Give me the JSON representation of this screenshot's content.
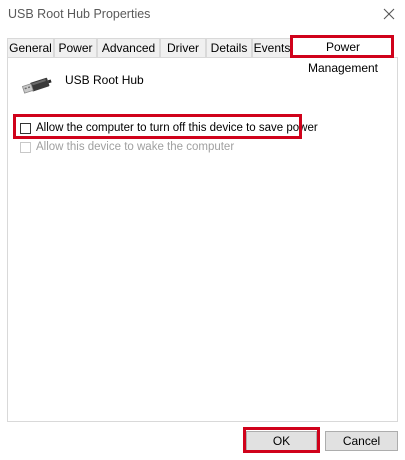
{
  "window": {
    "title": "USB Root Hub Properties",
    "close_icon": "close-icon"
  },
  "tabs": [
    {
      "label": "General"
    },
    {
      "label": "Power"
    },
    {
      "label": "Advanced"
    },
    {
      "label": "Driver"
    },
    {
      "label": "Details"
    },
    {
      "label": "Events"
    },
    {
      "label": "Power Management",
      "active": true
    }
  ],
  "device": {
    "icon": "usb-icon",
    "name": "USB Root Hub"
  },
  "options": [
    {
      "label": "Allow the computer to turn off this device to save power",
      "checked": false,
      "enabled": true
    },
    {
      "label": "Allow this device to wake the computer",
      "checked": false,
      "enabled": false
    }
  ],
  "buttons": {
    "ok": "OK",
    "cancel": "Cancel"
  },
  "colors": {
    "highlight": "#d0021b",
    "disabled_text": "#a0a0a0"
  }
}
